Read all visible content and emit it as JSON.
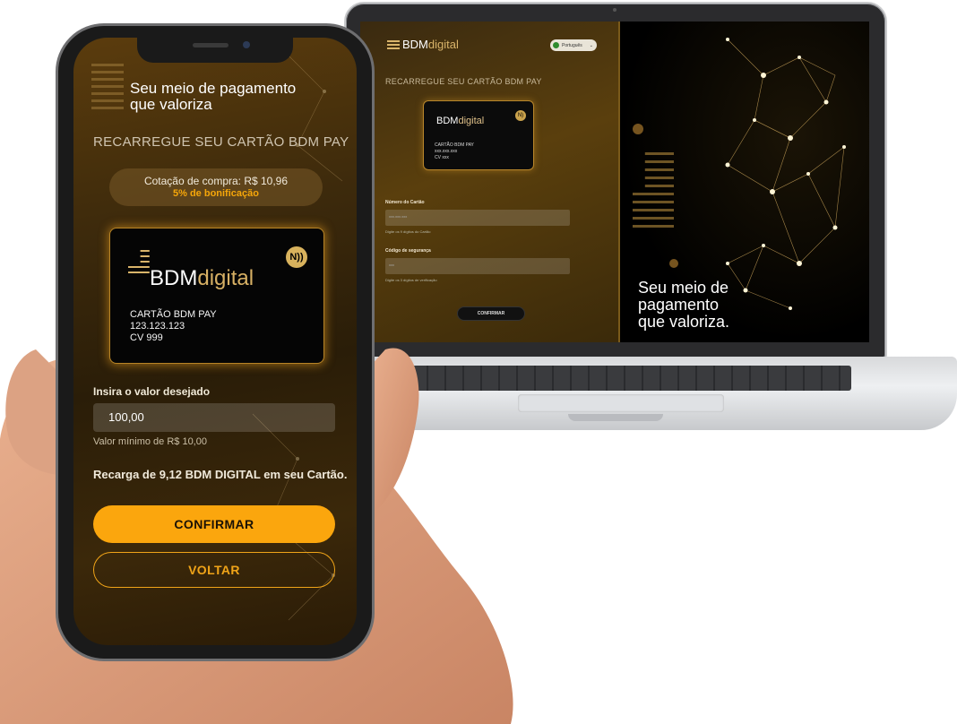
{
  "phone": {
    "tagline": "Seu meio de pagamento que valoriza",
    "title": "RECARREGUE SEU CARTÃO BDM PAY",
    "quote_line1": "Cotação de compra: R$ 10,96",
    "quote_line2": "5% de bonificação",
    "card": {
      "logo_main": "BDM",
      "logo_accent": "digital",
      "nfc_icon": "N))",
      "name": "CARTÃO BDM PAY",
      "number": "123.123.123",
      "cvv": "CV 999"
    },
    "amount_label": "Insira o valor desejado",
    "amount_value": "100,00",
    "amount_hint": "Valor mínimo de R$ 10,00",
    "summary": "Recarga de 9,12 BDM DIGITAL em seu Cartão.",
    "confirm_label": "CONFIRMAR",
    "back_label": "VOLTAR"
  },
  "laptop": {
    "logo_main": "BDM",
    "logo_accent": "digital",
    "language": "Português",
    "title": "RECARREGUE SEU CARTÃO BDM PAY",
    "card": {
      "logo_main": "BDM",
      "logo_accent": "digital",
      "name": "CARTÃO BDM PAY",
      "number": "xxx.xxx.xxx",
      "cvv": "CV xxx"
    },
    "card_number_label": "Número do Cartão",
    "card_number_placeholder": "xxx.xxx.xxx",
    "card_number_hint": "Digite os 9 dígitos do Cartão",
    "security_code_label": "Código de segurança",
    "security_code_placeholder": "xxx",
    "security_code_hint": "Digite os 3 dígitos de verificação",
    "confirm_label": "CONFIRMAR",
    "tagline_line1": "Seu meio de",
    "tagline_line2": "pagamento",
    "tagline_line3": "que valoriza."
  },
  "colors": {
    "accent_orange": "#fba60d",
    "gold": "#d7b064",
    "screen_bg": "#3d2a0c"
  }
}
